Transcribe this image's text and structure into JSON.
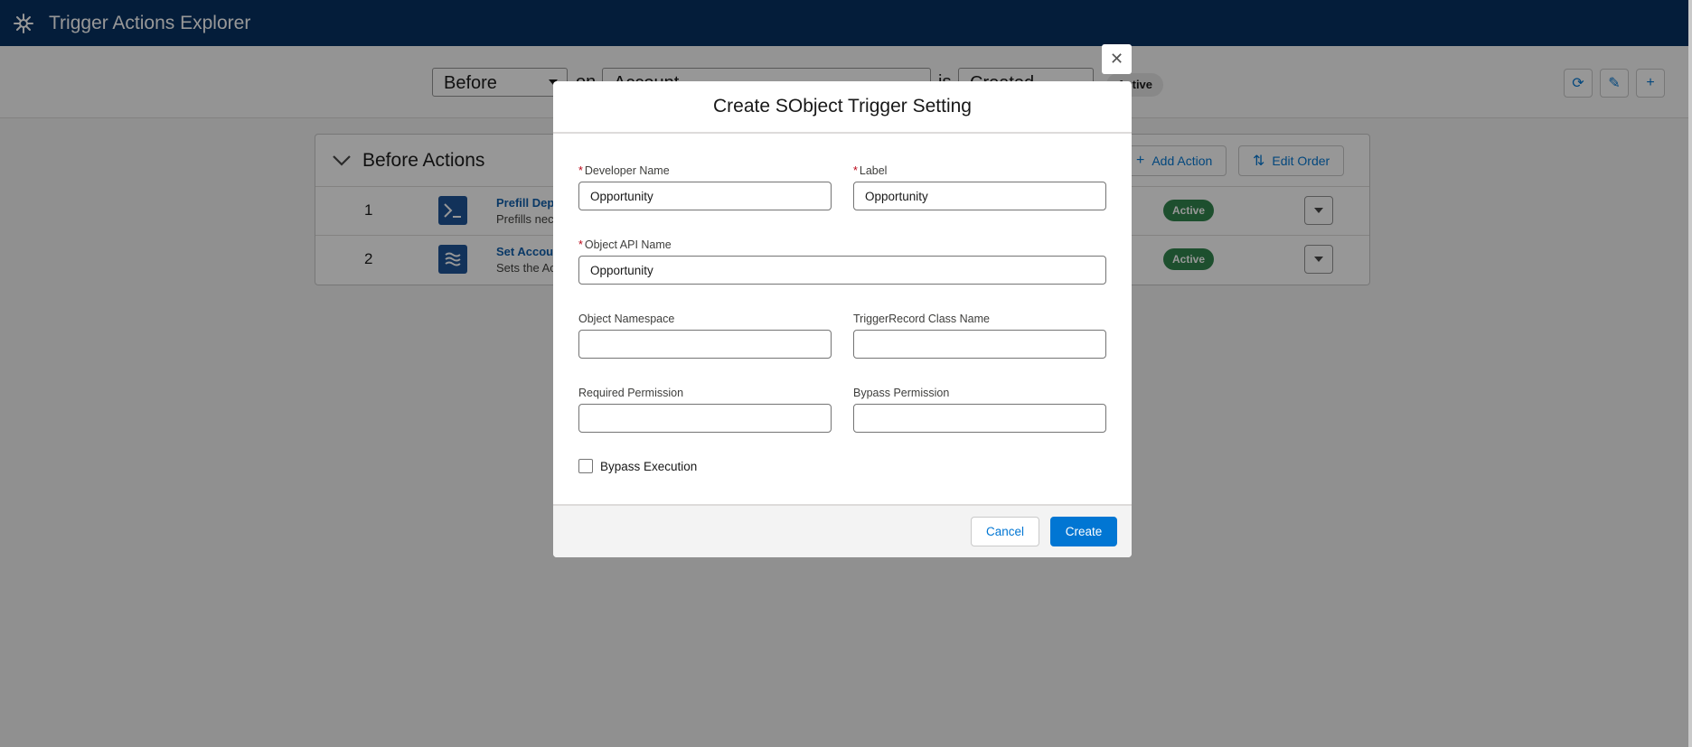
{
  "app": {
    "title": "Trigger Actions Explorer",
    "logo_icon": "salesforce-logo-icon"
  },
  "filter": {
    "context": "Before",
    "connector_on": "on",
    "object": "Account",
    "connector_is": "is",
    "event": "Created",
    "status_pill": "Active"
  },
  "card": {
    "title": "Before Actions",
    "add_action_label": "Add Action",
    "edit_order_label": "Edit Order",
    "rows": [
      {
        "order": "1",
        "name": "Prefill Dep",
        "description": "Prefills nec",
        "status": "Active",
        "icon": "apex-class-icon"
      },
      {
        "order": "2",
        "name": "Set Accou",
        "description": "Sets the Ac",
        "status": "Active",
        "icon": "flow-icon"
      }
    ]
  },
  "modal": {
    "title": "Create SObject Trigger Setting",
    "close_icon": "close-icon",
    "fields": {
      "developer_name": {
        "label": "Developer Name",
        "required": "*",
        "value": "Opportunity"
      },
      "label": {
        "label": "Label",
        "required": "*",
        "value": "Opportunity"
      },
      "object_api_name": {
        "label": "Object API Name",
        "required": "*",
        "value": "Opportunity"
      },
      "object_namespace": {
        "label": "Object Namespace",
        "value": ""
      },
      "trigger_record_class": {
        "label": "TriggerRecord Class Name",
        "value": ""
      },
      "required_permission": {
        "label": "Required Permission",
        "value": ""
      },
      "bypass_permission": {
        "label": "Bypass Permission",
        "value": ""
      }
    },
    "bypass_execution_label": "Bypass Execution",
    "bypass_execution_checked": false,
    "cancel_label": "Cancel",
    "create_label": "Create"
  },
  "colors": {
    "brand_header": "#032d60",
    "primary": "#0176d3",
    "success": "#2e844a"
  }
}
